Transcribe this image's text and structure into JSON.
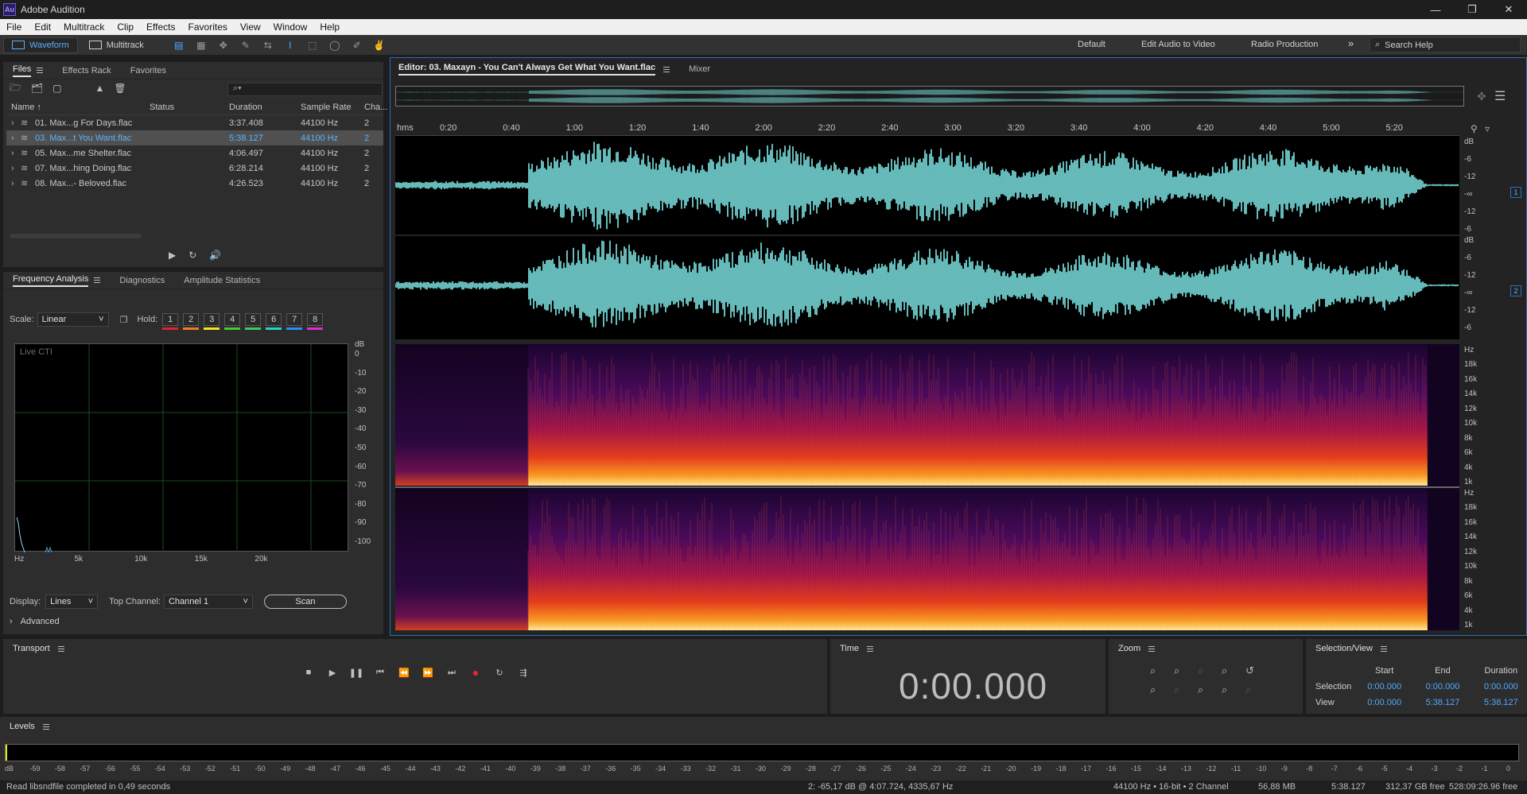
{
  "app": {
    "title": "Adobe Audition",
    "icon_text": "Au"
  },
  "menu": [
    "File",
    "Edit",
    "Multitrack",
    "Clip",
    "Effects",
    "Favorites",
    "View",
    "Window",
    "Help"
  ],
  "toolbar": {
    "waveform_label": "Waveform",
    "multitrack_label": "Multitrack",
    "workspaces": [
      "Default",
      "Edit Audio to Video",
      "Radio Production"
    ],
    "more": "»",
    "search_placeholder": "Search Help"
  },
  "files_panel": {
    "tabs": [
      "Files",
      "Effects Rack",
      "Favorites"
    ],
    "search_value": "⌕▾",
    "columns": [
      "Name ↑",
      "Status",
      "Duration",
      "Sample Rate",
      "Cha..."
    ],
    "rows": [
      {
        "name": "01. Max...g For Days.flac",
        "status": "",
        "duration": "3:37.408",
        "sample_rate": "44100 Hz",
        "channels": "2",
        "selected": false
      },
      {
        "name": "03. Max...t You Want.flac",
        "status": "",
        "duration": "5:38.127",
        "sample_rate": "44100 Hz",
        "channels": "2",
        "selected": true
      },
      {
        "name": "05. Max...me Shelter.flac",
        "status": "",
        "duration": "4:06.497",
        "sample_rate": "44100 Hz",
        "channels": "2",
        "selected": false
      },
      {
        "name": "07. Max...hing Doing.flac",
        "status": "",
        "duration": "6:28.214",
        "sample_rate": "44100 Hz",
        "channels": "2",
        "selected": false
      },
      {
        "name": "08. Max...- Beloved.flac",
        "status": "",
        "duration": "4:26.523",
        "sample_rate": "44100 Hz",
        "channels": "2",
        "selected": false
      }
    ]
  },
  "freq_panel": {
    "tabs": [
      "Frequency Analysis",
      "Diagnostics",
      "Amplitude Statistics"
    ],
    "scale_label": "Scale:",
    "scale_value": "Linear",
    "hold_label": "Hold:",
    "hold_buttons": [
      {
        "label": "1",
        "color": "#e0242a"
      },
      {
        "label": "2",
        "color": "#f07e1e"
      },
      {
        "label": "3",
        "color": "#f5e61a"
      },
      {
        "label": "4",
        "color": "#48c83a"
      },
      {
        "label": "5",
        "color": "#3acd5a"
      },
      {
        "label": "6",
        "color": "#22d3d3"
      },
      {
        "label": "7",
        "color": "#2b8ef0"
      },
      {
        "label": "8",
        "color": "#e12ad8"
      }
    ],
    "graph_label": "Live CTI",
    "y_unit": "dB",
    "y_ticks": [
      "0",
      "-10",
      "-20",
      "-30",
      "-40",
      "-50",
      "-60",
      "-70",
      "-80",
      "-90",
      "-100"
    ],
    "x_ticks": [
      "Hz",
      "5k",
      "10k",
      "15k",
      "20k"
    ],
    "display_label": "Display:",
    "display_value": "Lines",
    "top_channel_label": "Top Channel:",
    "top_channel_value": "Channel 1",
    "scan_label": "Scan",
    "advanced_label": "Advanced"
  },
  "editor": {
    "tab_label": "Editor: 03. Maxayn - You Can't Always Get What You Want.flac",
    "mixer_label": "Mixer",
    "timeline_ticks": [
      "hms",
      "0:20",
      "0:40",
      "1:00",
      "1:20",
      "1:40",
      "2:00",
      "2:20",
      "2:40",
      "3:00",
      "3:20",
      "3:40",
      "4:00",
      "4:20",
      "4:40",
      "5:00",
      "5:20"
    ],
    "db_labels": [
      "dB",
      "-6",
      "-12",
      "-∞",
      "-12",
      "-6"
    ],
    "hz_labels_1": [
      "Hz",
      "18k",
      "16k",
      "14k",
      "12k",
      "10k",
      "8k",
      "6k",
      "4k",
      "1k"
    ],
    "hz_labels_2": [
      "Hz",
      "18k",
      "16k",
      "14k",
      "12k",
      "10k",
      "8k",
      "6k",
      "4k",
      "1k"
    ],
    "channel_1": "1",
    "channel_2": "2",
    "waveform_color": "#7fe8e8"
  },
  "transport": {
    "title": "Transport"
  },
  "time": {
    "title": "Time",
    "value": "0:00.000"
  },
  "zoom": {
    "title": "Zoom"
  },
  "selection_view": {
    "title": "Selection/View",
    "headers": [
      "Start",
      "End",
      "Duration"
    ],
    "selection_label": "Selection",
    "selection": [
      "0:00.000",
      "0:00.000",
      "0:00.000"
    ],
    "view_label": "View",
    "view": [
      "0:00.000",
      "5:38.127",
      "5:38.127"
    ]
  },
  "levels": {
    "title": "Levels",
    "ticks": [
      "dB",
      "-59",
      "-58",
      "-57",
      "-56",
      "-55",
      "-54",
      "-53",
      "-52",
      "-51",
      "-50",
      "-49",
      "-48",
      "-47",
      "-46",
      "-45",
      "-44",
      "-43",
      "-42",
      "-41",
      "-40",
      "-39",
      "-38",
      "-37",
      "-36",
      "-35",
      "-34",
      "-33",
      "-32",
      "-31",
      "-30",
      "-29",
      "-28",
      "-27",
      "-26",
      "-25",
      "-24",
      "-23",
      "-22",
      "-21",
      "-20",
      "-19",
      "-18",
      "-17",
      "-16",
      "-15",
      "-14",
      "-13",
      "-12",
      "-11",
      "-10",
      "-9",
      "-8",
      "-7",
      "-6",
      "-5",
      "-4",
      "-3",
      "-2",
      "-1",
      "0"
    ]
  },
  "status": {
    "left": "Read libsndfile completed in 0,49 seconds",
    "cursor": "2: -65,17 dB @ 4:07.724, 4335,67 Hz",
    "format": "44100 Hz • 16-bit • 2 Channel",
    "size": "56,88 MB",
    "duration": "5:38.127",
    "free": "312,37 GB free",
    "free_time": "528:09:26.96 free"
  }
}
